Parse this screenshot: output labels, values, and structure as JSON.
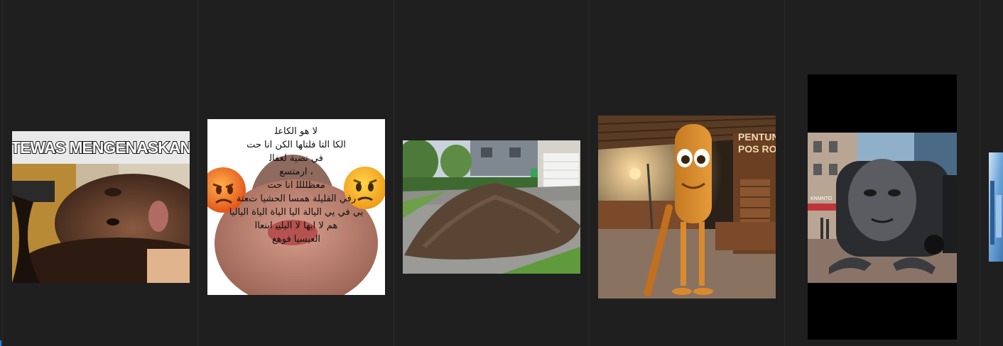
{
  "colors": {
    "background": "#1f1f1f",
    "divider": "#2c2c2c",
    "edge_mark": "#1e88e5"
  },
  "thumbnails": [
    {
      "name": "dead-man-meme",
      "caption": "TEWAS MENGENASKAN"
    },
    {
      "name": "bald-head-emoji-meme",
      "overlay_text": "ﻻ ﻫﻮ ﺍﻟﻜﺎﻋﻠ\nﺍﻟﻜﺎ ﺍﻟﺘﺎ ﻓﻠﺘﺎﻬﺎ ﺍﻟﻜﻦ ﺍﻧﺎ ﺣﺖ\nﻓﻲ ﻧﻀﻴﺔ ﻟﻌﻔﺎﻟ\n، ﺍﺭﻣﺘﺴﻊ\nﻣﻌﻈﻠﻠﻠﻠ ﺍﻧﺎ ﺣﺖ\nﺭﻓﻲ ﺍﻟﻘﻠﻴﻠﺔ ﻫﻤﺴﺎ ﺍﻟﺤﺸﻴﺎ ﺕﻌﺘﺔ\nﻳﻲ ﻓﻲ ﻳﻲ ﺍﻟﻴﺎﻟﺔ ﺍﻟﻴﺎ ﺍﻟﻴﺎﺓ ﺍﻟﻴﺎﺓ ﺍﻟﻴﺎﻟﻴﺎ\nﻫﻢ ﻻ ﺍﻳﻬﺎ ﻻ ﺍﻟﻴﻠﻴﻴ ﺍﺑﻨﻌﺎﺍ\nﺍﻟﻌﻴﺴﻴﺎ ﻓﻮﻫﻊ"
    },
    {
      "name": "dirt-pile-photo"
    },
    {
      "name": "wooden-figure-bat-photo",
      "sign_text": "PENTUNG\nPOS RON"
    },
    {
      "name": "bus-face-creature-photo",
      "shop_text": "KNMNTO"
    },
    {
      "name": "partial-blue-thumbnail"
    }
  ]
}
